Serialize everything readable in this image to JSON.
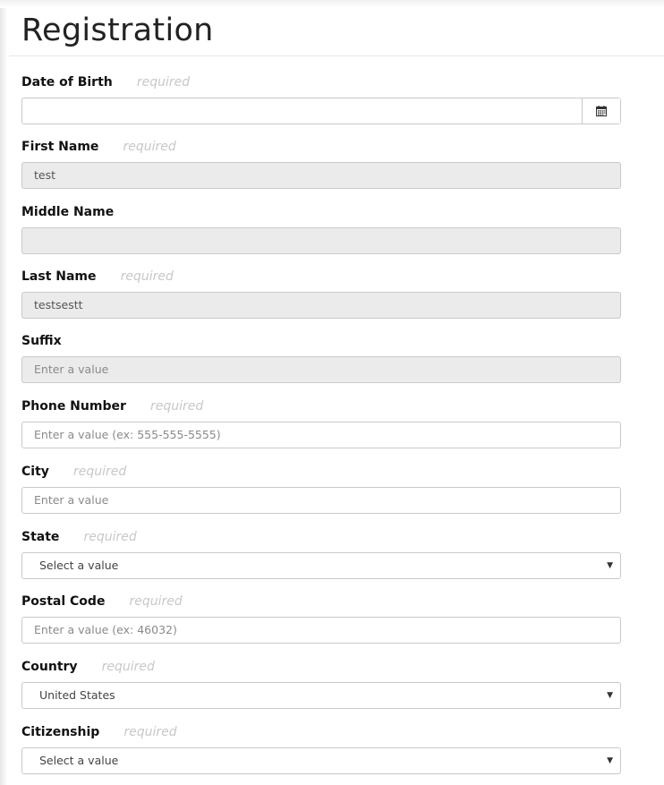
{
  "page": {
    "title": "Registration"
  },
  "form": {
    "required_text": "required",
    "fields": [
      {
        "label": "Date of Birth",
        "required": true,
        "type": "date",
        "value": "",
        "icon": "calendar-icon"
      },
      {
        "label": "First Name",
        "required": true,
        "type": "text",
        "value": "test"
      },
      {
        "label": "Middle Name",
        "required": false,
        "type": "text",
        "value": ""
      },
      {
        "label": "Last Name",
        "required": true,
        "type": "text",
        "value": "testsestt"
      },
      {
        "label": "Suffix",
        "required": false,
        "type": "text",
        "value": "",
        "placeholder": "Enter a value"
      },
      {
        "label": "Phone Number",
        "required": true,
        "type": "text",
        "value": "",
        "placeholder": "Enter a value (ex: 555-555-5555)"
      },
      {
        "label": "City",
        "required": true,
        "type": "text",
        "value": "",
        "placeholder": "Enter a value"
      },
      {
        "label": "State",
        "required": true,
        "type": "select",
        "selected": "Select a value"
      },
      {
        "label": "Postal Code",
        "required": true,
        "type": "text",
        "value": "",
        "placeholder": "Enter a value (ex: 46032)"
      },
      {
        "label": "Country",
        "required": true,
        "type": "select",
        "selected": "United States"
      },
      {
        "label": "Citizenship",
        "required": true,
        "type": "select",
        "selected": "Select a value"
      }
    ]
  },
  "colors": {
    "disabled_background": "#ebebeb",
    "border": "#c9c9c9",
    "required_hint": "#c8c8c8"
  }
}
